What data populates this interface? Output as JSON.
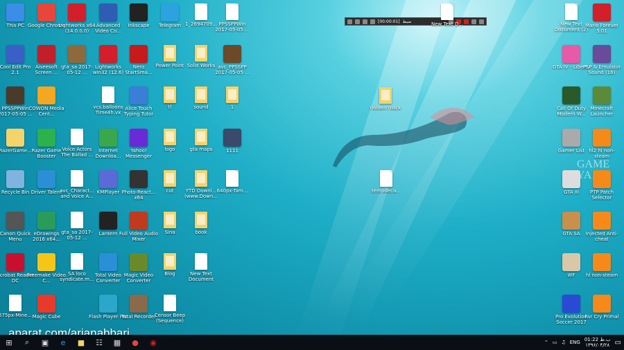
{
  "desktop_icons_left": [
    {
      "label": "This PC",
      "icon": "computer-icon",
      "color": "#3a8ee6"
    },
    {
      "label": "Google Chrome",
      "icon": "chrome-icon",
      "color": "#e8453c"
    },
    {
      "label": "Lightworks x64 (14.0.0.0)",
      "icon": "lightworks-icon",
      "color": "#d21f2a"
    },
    {
      "label": "Advanced Video Co...",
      "icon": "advanced-video-icon",
      "color": "#2f5db3"
    },
    {
      "label": "Inkscape",
      "icon": "inkscape-icon",
      "color": "#222222"
    },
    {
      "label": "Telegram",
      "icon": "telegram-icon",
      "color": "#2ba3de"
    },
    {
      "label": "1_2694709...",
      "icon": "image-file-icon",
      "color": "#f1e6c2"
    },
    {
      "label": "PPSSPPWin 2017-05-05 ...",
      "icon": "file-icon",
      "color": "#ffffff"
    },
    {
      "label": "Cool Edit Pro 2.1",
      "icon": "cool-edit-icon",
      "color": "#3a5fc7"
    },
    {
      "label": "Aiseesoft Screen ...",
      "icon": "aiseesoft-icon",
      "color": "#c21f29"
    },
    {
      "label": "gta_sa 2017-05-12 ...",
      "icon": "screenshot-icon",
      "color": "#8c6a3c"
    },
    {
      "label": "Lightworks win32 (12.6)",
      "icon": "lightworks-icon",
      "color": "#d21f2a"
    },
    {
      "label": "Nero StartSma...",
      "icon": "nero-icon",
      "color": "#c61b1b"
    },
    {
      "label": "Power Point",
      "icon": "folder-icon",
      "color": "#f4d36b"
    },
    {
      "label": "Solid Works",
      "icon": "folder-icon",
      "color": "#f4d36b"
    },
    {
      "label": "avc_PPSSPP 2017-05-05 ...",
      "icon": "screenshot-icon",
      "color": "#6b4a2a"
    },
    {
      "label": "PPSSPPWin 2017-05-05 ...",
      "icon": "screenshot-icon",
      "color": "#4a3a2a"
    },
    {
      "label": "COWON Media Cent...",
      "icon": "cowon-icon",
      "color": "#f5a623"
    },
    {
      "label": "vcs.balloons Time4h.vx",
      "icon": "file-icon",
      "color": "#ffffff"
    },
    {
      "label": "Alice Touch Typing Tutor",
      "icon": "alice-icon",
      "color": "#3a7ed8"
    },
    {
      "label": "tl",
      "icon": "folder-icon",
      "color": "#f4d36b"
    },
    {
      "label": "sound",
      "icon": "folder-icon",
      "color": "#f4d36b"
    },
    {
      "label": "1",
      "icon": "folder-icon",
      "color": "#f4d36b"
    },
    {
      "label": "RazerGame...",
      "icon": "razer-icon",
      "color": "#f4d36b"
    },
    {
      "label": "Razer Game Booster",
      "icon": "razer-booster-icon",
      "color": "#2bb24c"
    },
    {
      "label": "Voice Actors The Ballad ...",
      "icon": "file-icon",
      "color": "#ffffff"
    },
    {
      "label": "Internet Downloa...",
      "icon": "idm-icon",
      "color": "#3aa84a"
    },
    {
      "label": "Yahoo! Messenger",
      "icon": "yahoo-icon",
      "color": "#6a2bd6"
    },
    {
      "label": "logo",
      "icon": "folder-icon",
      "color": "#f4d36b"
    },
    {
      "label": "gta maps",
      "icon": "folder-icon",
      "color": "#f4d36b"
    },
    {
      "label": "1111",
      "icon": "screenshot-icon",
      "color": "#3a4a6a"
    },
    {
      "label": "Recycle Bin",
      "icon": "recycle-bin-icon",
      "color": "#7fb3e0"
    },
    {
      "label": "Driver Talent",
      "icon": "driver-talent-icon",
      "color": "#2b8fd6"
    },
    {
      "label": "avc_Charact... and Voice A...",
      "icon": "file-icon",
      "color": "#ffffff"
    },
    {
      "label": "KMPlayer",
      "icon": "kmplayer-icon",
      "color": "#5a6ad6"
    },
    {
      "label": "Photo-React... x64",
      "icon": "photo-react-icon",
      "color": "#333333"
    },
    {
      "label": "cut",
      "icon": "folder-icon",
      "color": "#f4d36b"
    },
    {
      "label": "YTD Downl... (www.Down...",
      "icon": "folder-icon",
      "color": "#f4d36b"
    },
    {
      "label": "640px-Tam...",
      "icon": "image-file-icon",
      "color": "#ffffff"
    },
    {
      "label": "Canon Quick Menu",
      "icon": "canon-icon",
      "color": "#555555"
    },
    {
      "label": "eDrawings 2016 x64...",
      "icon": "edrawings-icon",
      "color": "#2a9c5a"
    },
    {
      "label": "gta_sa 2017-05-12 ...",
      "icon": "file-icon",
      "color": "#ffffff"
    },
    {
      "label": "Lantern",
      "icon": "lantern-icon",
      "color": "#222222"
    },
    {
      "label": "Full Video Audio Mixer",
      "icon": "video-mixer-icon",
      "color": "#c23a1e"
    },
    {
      "label": "Sina",
      "icon": "folder-icon",
      "color": "#f4d36b"
    },
    {
      "label": "book",
      "icon": "folder-icon",
      "color": "#f4d36b"
    },
    {
      "label": "Acrobat Reader DC",
      "icon": "acrobat-icon",
      "color": "#c8102e"
    },
    {
      "label": "Freemake Video C...",
      "icon": "freemake-icon",
      "color": "#f5c518"
    },
    {
      "label": "SA loco syndicate.m...",
      "icon": "file-icon",
      "color": "#ffffff"
    },
    {
      "label": "Total Video Converter",
      "icon": "total-video-icon",
      "color": "#2a8fd6"
    },
    {
      "label": "Magic Video Converter",
      "icon": "magic-video-icon",
      "color": "#6a8a2a"
    },
    {
      "label": "Blog",
      "icon": "folder-icon",
      "color": "#f4d36b"
    },
    {
      "label": "New Text Document",
      "icon": "file-icon",
      "color": "#ffffff"
    },
    {
      "label": "675px-Mine...",
      "icon": "file-icon",
      "color": "#ffffff"
    },
    {
      "label": "Magic Cube",
      "icon": "magic-cube-icon",
      "color": "#e83a2a"
    },
    {
      "label": "Flash Player Pro",
      "icon": "flash-player-icon",
      "color": "#2aa7c9"
    },
    {
      "label": "Total Recorder",
      "icon": "total-recorder-icon",
      "color": "#8a6a4a"
    },
    {
      "label": "Censor Beep (Sequence)",
      "icon": "audio-file-icon",
      "color": "#ffffff"
    }
  ],
  "desktop_icons_mid": [
    {
      "label": "golden glock",
      "icon": "folder-icon",
      "color": "#f4d36b"
    },
    {
      "label": "tempdeca...",
      "icon": "file-icon",
      "color": "#ffffff"
    },
    {
      "label": "New Text D...",
      "icon": "file-icon",
      "color": "#ffffff"
    }
  ],
  "desktop_icons_right": [
    {
      "label": "New Text Document (2)",
      "icon": "file-icon",
      "color": "#ffffff"
    },
    {
      "label": "Mario Forever 5.01",
      "icon": "mario-icon",
      "color": "#d21f2a"
    },
    {
      "label": "GTA IV - Liberty",
      "icon": "gta-iv-icon",
      "color": "#e85aa8"
    },
    {
      "label": "PSP & Emulator Sound (16)",
      "icon": "psp-icon",
      "color": "#6a4a9a"
    },
    {
      "label": "Call Of Duty Modern W...",
      "icon": "cod-icon",
      "color": "#2a5a2a"
    },
    {
      "label": "Minecraft Launcher",
      "icon": "minecraft-icon",
      "color": "#5a8a3a"
    },
    {
      "label": "Gamer List",
      "icon": "gamer-list-icon",
      "color": "#aaaaaa"
    },
    {
      "label": "hl2 hl non-steam",
      "icon": "half-life-icon",
      "color": "#f58a1a"
    },
    {
      "label": "GTA III",
      "icon": "gta-iii-icon",
      "color": "#dddddd"
    },
    {
      "label": "PTP Patch Selector",
      "icon": "ptp-patch-icon",
      "color": "#f58a1a"
    },
    {
      "label": "GTA SA",
      "icon": "gta-sa-icon",
      "color": "#c8904a"
    },
    {
      "label": "Injected Anti-cheat",
      "icon": "injected-icon",
      "color": "#f58a1a"
    },
    {
      "label": "WF",
      "icon": "wf-icon",
      "color": "#d8c8a8"
    },
    {
      "label": "hl non-steam",
      "icon": "half-life-icon",
      "color": "#f58a1a"
    },
    {
      "label": "Pro Evolution Soccer 2017",
      "icon": "pes-icon",
      "color": "#2a4ad6"
    },
    {
      "label": "Far Cry Primal",
      "icon": "far-cry-icon",
      "color": "#f58a1a"
    }
  ],
  "recorder": {
    "time": "[00:00:01]",
    "status": "ضبط"
  },
  "watermark": "aparat.com/arianabbari",
  "game_watermark": "GAME\nYAAR",
  "taskbar": {
    "items": [
      "start-icon",
      "search-icon",
      "task-view-icon",
      "edge-icon",
      "file-explorer-icon",
      "network-icon",
      "store-icon",
      "chrome-icon",
      "recorder-app-icon"
    ],
    "tray": {
      "language": "ENG",
      "time": "01:22 ب.ظ",
      "date": "۱۳۹۶/۰۴/۲۸"
    }
  }
}
